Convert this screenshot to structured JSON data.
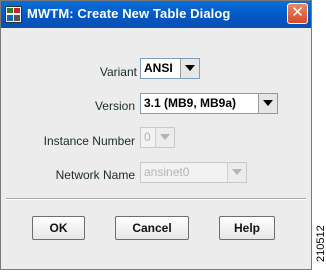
{
  "window": {
    "title": "MWTM: Create New Table Dialog",
    "close_glyph": "✕"
  },
  "fields": {
    "variant": {
      "label": "Variant",
      "value": "ANSI",
      "enabled": true
    },
    "version": {
      "label": "Version",
      "value": "3.1  (MB9, MB9a)",
      "enabled": true
    },
    "instance_number": {
      "label": "Instance Number",
      "value": "0",
      "enabled": false
    },
    "network_name": {
      "label": "Network Name",
      "value": "ansinet0",
      "enabled": false
    }
  },
  "buttons": {
    "ok": "OK",
    "cancel": "Cancel",
    "help": "Help"
  },
  "side_code": "210512",
  "icons": {
    "app": "app-icon",
    "close": "close-icon",
    "dropdown": "chevron-down-icon"
  },
  "colors": {
    "titlebar": "#0458c4",
    "close_button": "#d54a25",
    "field_label": "#1a2a2a"
  }
}
